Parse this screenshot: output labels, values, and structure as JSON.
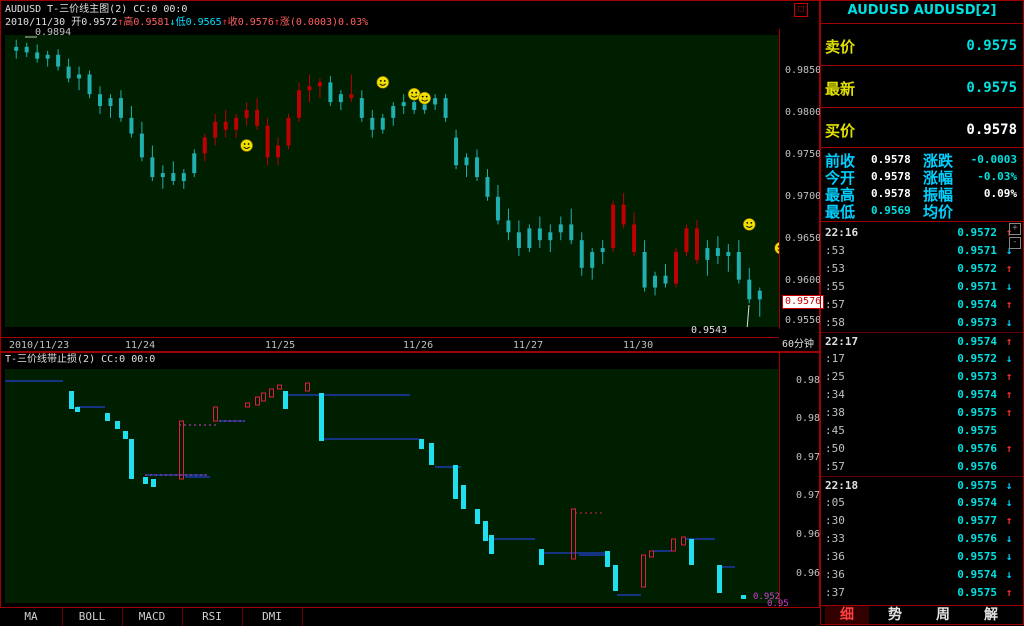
{
  "main_chart": {
    "title": "AUDUSD T-三价线主图(2) CC:0 00:0",
    "ohlc_line": {
      "date": "2010/11/30",
      "open_label": "开",
      "open": "0.9572",
      "high_label": "高",
      "high": "0.9581",
      "low_label": "低",
      "low": "0.9565",
      "close_label": "收",
      "close": "0.9576",
      "change_label": "涨",
      "change": "(0.0003)",
      "change_pct": "0.03%"
    },
    "high_marker": "0.9894",
    "low_marker": "0.9543",
    "current_price_tag": "0.9576",
    "y_ticks": [
      "0.9850",
      "0.9800",
      "0.9750",
      "0.9700",
      "0.9650",
      "0.9600",
      "0.9550"
    ],
    "x_ticks": [
      "2010/11/23",
      "11/24",
      "11/25",
      "11/26",
      "11/27",
      "11/30"
    ],
    "period": "60分钟"
  },
  "chart_data": {
    "type": "candlestick",
    "y_range": [
      0.953,
      0.99
    ],
    "candles": [
      [
        0.988,
        0.9894,
        0.987,
        0.9885,
        "up"
      ],
      [
        0.9885,
        0.989,
        0.9872,
        0.9878,
        "up"
      ],
      [
        0.9878,
        0.9888,
        0.9865,
        0.987,
        "up"
      ],
      [
        0.987,
        0.988,
        0.986,
        0.9875,
        "up"
      ],
      [
        0.9875,
        0.9882,
        0.9855,
        0.986,
        "up"
      ],
      [
        0.986,
        0.987,
        0.984,
        0.9845,
        "up"
      ],
      [
        0.9845,
        0.986,
        0.983,
        0.985,
        "up"
      ],
      [
        0.985,
        0.9855,
        0.982,
        0.9825,
        "up"
      ],
      [
        0.9825,
        0.9835,
        0.98,
        0.981,
        "up"
      ],
      [
        0.981,
        0.9825,
        0.9795,
        0.982,
        "up"
      ],
      [
        0.982,
        0.983,
        0.979,
        0.9795,
        "up"
      ],
      [
        0.9795,
        0.981,
        0.977,
        0.9775,
        "up"
      ],
      [
        0.9775,
        0.979,
        0.974,
        0.9745,
        "up"
      ],
      [
        0.9745,
        0.976,
        0.9715,
        0.972,
        "up"
      ],
      [
        0.972,
        0.9735,
        0.9705,
        0.9725,
        "up"
      ],
      [
        0.9725,
        0.974,
        0.971,
        0.9715,
        "up"
      ],
      [
        0.9715,
        0.973,
        0.9705,
        0.9725,
        "up"
      ],
      [
        0.9725,
        0.9755,
        0.972,
        0.975,
        "up"
      ],
      [
        0.975,
        0.9775,
        0.974,
        0.977,
        "down"
      ],
      [
        0.977,
        0.98,
        0.976,
        0.979,
        "down"
      ],
      [
        0.979,
        0.9805,
        0.977,
        0.978,
        "down"
      ],
      [
        0.978,
        0.98,
        0.977,
        0.9795,
        "down"
      ],
      [
        0.9795,
        0.9815,
        0.9785,
        0.9805,
        "down"
      ],
      [
        0.9805,
        0.982,
        0.978,
        0.9785,
        "down"
      ],
      [
        0.9785,
        0.9795,
        0.9735,
        0.9745,
        "down"
      ],
      [
        0.9745,
        0.977,
        0.9735,
        0.976,
        "down"
      ],
      [
        0.976,
        0.98,
        0.9755,
        0.9795,
        "down"
      ],
      [
        0.9795,
        0.984,
        0.979,
        0.983,
        "down"
      ],
      [
        0.983,
        0.985,
        0.9815,
        0.9835,
        "down"
      ],
      [
        0.9835,
        0.9845,
        0.982,
        0.984,
        "down"
      ],
      [
        0.984,
        0.9848,
        0.981,
        0.9815,
        "up"
      ],
      [
        0.9815,
        0.983,
        0.9805,
        0.9825,
        "up"
      ],
      [
        0.9825,
        0.985,
        0.9815,
        0.982,
        "down"
      ],
      [
        0.982,
        0.983,
        0.979,
        0.9795,
        "up"
      ],
      [
        0.9795,
        0.9805,
        0.977,
        0.978,
        "up"
      ],
      [
        0.978,
        0.98,
        0.9775,
        0.9795,
        "up"
      ],
      [
        0.9795,
        0.9815,
        0.9785,
        0.981,
        "up"
      ],
      [
        0.981,
        0.9825,
        0.98,
        0.9815,
        "up"
      ],
      [
        0.9815,
        0.9822,
        0.98,
        0.9805,
        "up"
      ],
      [
        0.9805,
        0.982,
        0.98,
        0.9812,
        "up"
      ],
      [
        0.9812,
        0.9825,
        0.9805,
        0.982,
        "up"
      ],
      [
        0.982,
        0.9825,
        0.979,
        0.9795,
        "up"
      ],
      [
        0.977,
        0.978,
        0.973,
        0.9735,
        "up"
      ],
      [
        0.9735,
        0.975,
        0.972,
        0.9745,
        "up"
      ],
      [
        0.9745,
        0.9755,
        0.9715,
        0.972,
        "up"
      ],
      [
        0.972,
        0.973,
        0.969,
        0.9695,
        "up"
      ],
      [
        0.9695,
        0.971,
        0.966,
        0.9665,
        "up"
      ],
      [
        0.9665,
        0.968,
        0.964,
        0.965,
        "up"
      ],
      [
        0.965,
        0.9665,
        0.962,
        0.963,
        "up"
      ],
      [
        0.963,
        0.966,
        0.9625,
        0.9655,
        "up"
      ],
      [
        0.9655,
        0.967,
        0.963,
        0.964,
        "up"
      ],
      [
        0.964,
        0.966,
        0.9625,
        0.965,
        "up"
      ],
      [
        0.965,
        0.967,
        0.964,
        0.966,
        "up"
      ],
      [
        0.966,
        0.968,
        0.9635,
        0.964,
        "up"
      ],
      [
        0.964,
        0.965,
        0.9595,
        0.9605,
        "up"
      ],
      [
        0.9605,
        0.963,
        0.959,
        0.9625,
        "up"
      ],
      [
        0.9625,
        0.964,
        0.961,
        0.963,
        "up"
      ],
      [
        0.963,
        0.969,
        0.9625,
        0.9685,
        "down"
      ],
      [
        0.9685,
        0.97,
        0.9655,
        0.966,
        "down"
      ],
      [
        0.966,
        0.9675,
        0.962,
        0.9625,
        "down"
      ],
      [
        0.9625,
        0.964,
        0.9575,
        0.958,
        "up"
      ],
      [
        0.958,
        0.96,
        0.957,
        0.9595,
        "up"
      ],
      [
        0.9595,
        0.961,
        0.958,
        0.9585,
        "up"
      ],
      [
        0.9585,
        0.963,
        0.958,
        0.9625,
        "down"
      ],
      [
        0.9625,
        0.966,
        0.962,
        0.9655,
        "down"
      ],
      [
        0.9655,
        0.9665,
        0.961,
        0.9615,
        "down"
      ],
      [
        0.9615,
        0.964,
        0.9595,
        0.963,
        "up"
      ],
      [
        0.963,
        0.9645,
        0.961,
        0.962,
        "up"
      ],
      [
        0.962,
        0.9635,
        0.96,
        0.9625,
        "up"
      ],
      [
        0.9625,
        0.964,
        0.9585,
        0.959,
        "up"
      ],
      [
        0.959,
        0.9605,
        0.956,
        0.9565,
        "up"
      ],
      [
        0.9565,
        0.958,
        0.9543,
        0.9576,
        "up"
      ]
    ],
    "signal_icons": [
      [
        22,
        0.976
      ],
      [
        35,
        0.984
      ],
      [
        38,
        0.9825
      ],
      [
        39,
        0.982
      ],
      [
        70,
        0.966
      ],
      [
        73,
        0.963
      ],
      [
        76,
        0.9585
      ],
      [
        82,
        0.9625
      ]
    ]
  },
  "sub_chart": {
    "title": "T-三价线带止损(2) CC:0 00:0",
    "y_ticks": [
      "0.98",
      "0.98",
      "0.97",
      "0.97",
      "0.96",
      "0.96"
    ],
    "last_values": [
      "0.952",
      "0.95"
    ]
  },
  "bottom_tabs": [
    "MA",
    "BOLL",
    "MACD",
    "RSI",
    "DMI"
  ],
  "quote_panel": {
    "title": "AUDUSD AUDUSD[2]",
    "sell_label": "卖价",
    "sell": "0.9575",
    "latest_label": "最新",
    "latest": "0.9575",
    "buy_label": "买价",
    "buy": "0.9578",
    "prev_close_label": "前收",
    "prev_close": "0.9578",
    "change_label": "涨跌",
    "change": "-0.0003",
    "open_label": "今开",
    "open": "0.9578",
    "change_pct_label": "涨幅",
    "change_pct": "-0.03%",
    "high_label": "最高",
    "high": "0.9578",
    "amplitude_label": "振幅",
    "amplitude": "0.09%",
    "low_label": "最低",
    "low": "0.9569",
    "avg_label": "均价",
    "avg": ""
  },
  "ticks": [
    {
      "time": "22:16",
      "price": "0.9572",
      "dir": "up"
    },
    {
      "time": ":53",
      "price": "0.9571",
      "dir": "down"
    },
    {
      "time": ":53",
      "price": "0.9572",
      "dir": "up"
    },
    {
      "time": ":55",
      "price": "0.9571",
      "dir": "down"
    },
    {
      "time": ":57",
      "price": "0.9574",
      "dir": "up"
    },
    {
      "time": ":58",
      "price": "0.9573",
      "dir": "down"
    },
    {
      "time": "22:17",
      "price": "0.9574",
      "dir": "up"
    },
    {
      "time": ":17",
      "price": "0.9572",
      "dir": "down"
    },
    {
      "time": ":25",
      "price": "0.9573",
      "dir": "up"
    },
    {
      "time": ":34",
      "price": "0.9574",
      "dir": "up"
    },
    {
      "time": ":38",
      "price": "0.9575",
      "dir": "up"
    },
    {
      "time": ":45",
      "price": "0.9575",
      "dir": ""
    },
    {
      "time": ":50",
      "price": "0.9576",
      "dir": "up"
    },
    {
      "time": ":57",
      "price": "0.9576",
      "dir": ""
    },
    {
      "time": "22:18",
      "price": "0.9575",
      "dir": "down"
    },
    {
      "time": ":05",
      "price": "0.9574",
      "dir": "down"
    },
    {
      "time": ":30",
      "price": "0.9577",
      "dir": "up"
    },
    {
      "time": ":33",
      "price": "0.9576",
      "dir": "down"
    },
    {
      "time": ":36",
      "price": "0.9575",
      "dir": "down"
    },
    {
      "time": ":36",
      "price": "0.9574",
      "dir": "down"
    },
    {
      "time": ":37",
      "price": "0.9575",
      "dir": "up"
    }
  ],
  "right_tabs": [
    "细",
    "势",
    "周",
    "解"
  ],
  "colors": {
    "up": "#ff3030",
    "down": "#00d0ff",
    "candle_up": "#20b0b0",
    "candle_down": "#c00000",
    "chart_bg": "#001e00"
  }
}
